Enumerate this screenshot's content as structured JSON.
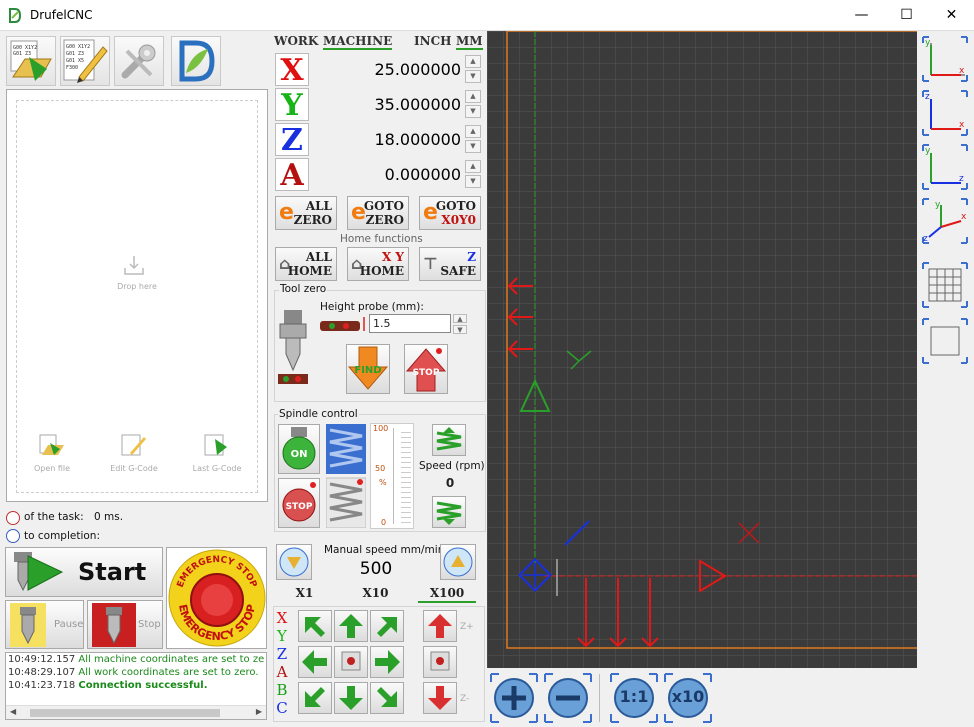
{
  "window": {
    "title": "DrufelCNC",
    "minimize": "—",
    "maximize": "☐",
    "close": "✕"
  },
  "toolbar": {
    "icons": [
      "open-file-icon",
      "edit-gcode-icon",
      "settings-wrench-icon",
      "drufelcnc-logo-icon"
    ],
    "gcode_sample": "G00 X1Y2 F\nG01 Z3\nG01 X5"
  },
  "file_area": {
    "drop_label": "Drop here",
    "open_file": "Open file",
    "edit_gcode": "Edit G-Code",
    "last_gcode": "Last G-Code"
  },
  "status": {
    "task_label": "of the task:",
    "task_value": "0 ms.",
    "completion_label": "to completion:"
  },
  "controls": {
    "start": "Start",
    "pause": "Pause",
    "stop": "Stop",
    "emergency_top": "EMERGENCY STOP",
    "emergency_bottom": "EMERGENCY STOP"
  },
  "log": [
    {
      "time": "10:49:12.157",
      "text": "All machine coordinates are set to ze"
    },
    {
      "time": "10:48:29.107",
      "text": "All work coordinates are set to zero."
    },
    {
      "time": "10:41:23.718",
      "text": "Connection successful."
    }
  ],
  "coords": {
    "work_label": "WORK",
    "machine_label": "MACHINE",
    "inch_label": "INCH",
    "mm_label": "MM",
    "axes": [
      {
        "letter": "X",
        "value": "25.000000",
        "color": "#e01010"
      },
      {
        "letter": "Y",
        "value": "35.000000",
        "color": "#18b418"
      },
      {
        "letter": "Z",
        "value": "18.000000",
        "color": "#1830e0"
      },
      {
        "letter": "A",
        "value": "0.000000",
        "color": "#b41010"
      }
    ]
  },
  "zero_buttons": {
    "all_zero_1": "ALL",
    "all_zero_2": "ZERO",
    "goto_zero_1": "GOTO",
    "goto_zero_2": "ZERO",
    "goto_x0y0_1": "GOTO",
    "goto_x0y0_2": "X0Y0"
  },
  "home": {
    "title": "Home functions",
    "all_home_1": "ALL",
    "all_home_2": "HOME",
    "xy_home_1": "X Y",
    "xy_home_2": "HOME",
    "z_safe_1": "Z",
    "z_safe_2": "SAFE"
  },
  "tool_zero": {
    "title": "Tool zero",
    "height_label": "Height probe (mm):",
    "height_value": "1.5",
    "find": "FIND",
    "stop": "STOP"
  },
  "spindle": {
    "title": "Spindle control",
    "on": "ON",
    "stop": "STOP",
    "scale_100": "100",
    "scale_50": "50",
    "scale_pct": "%",
    "scale_0": "0",
    "speed_label": "Speed (rpm)",
    "speed_value": "0"
  },
  "manual": {
    "label": "Manual speed mm/min",
    "value": "500",
    "x1": "X1",
    "x10": "X10",
    "x100": "X100"
  },
  "jog": {
    "axis_letters": [
      "X",
      "Y",
      "Z",
      "A",
      "B",
      "C"
    ],
    "axis_colors": [
      "#e01010",
      "#18b418",
      "#1830e0",
      "#b41010",
      "#18a018",
      "#1830e0"
    ],
    "zplus": "Z+",
    "zminus": "Z-"
  },
  "view": {
    "fit_label": "1:1",
    "x10_label": "x10"
  },
  "colors": {
    "accent_green": "#2aa02a",
    "canvas_bg": "#3b3b3b",
    "grid": "#555555",
    "border_orange": "#e07a20",
    "toolpath_red": "#e01818"
  }
}
